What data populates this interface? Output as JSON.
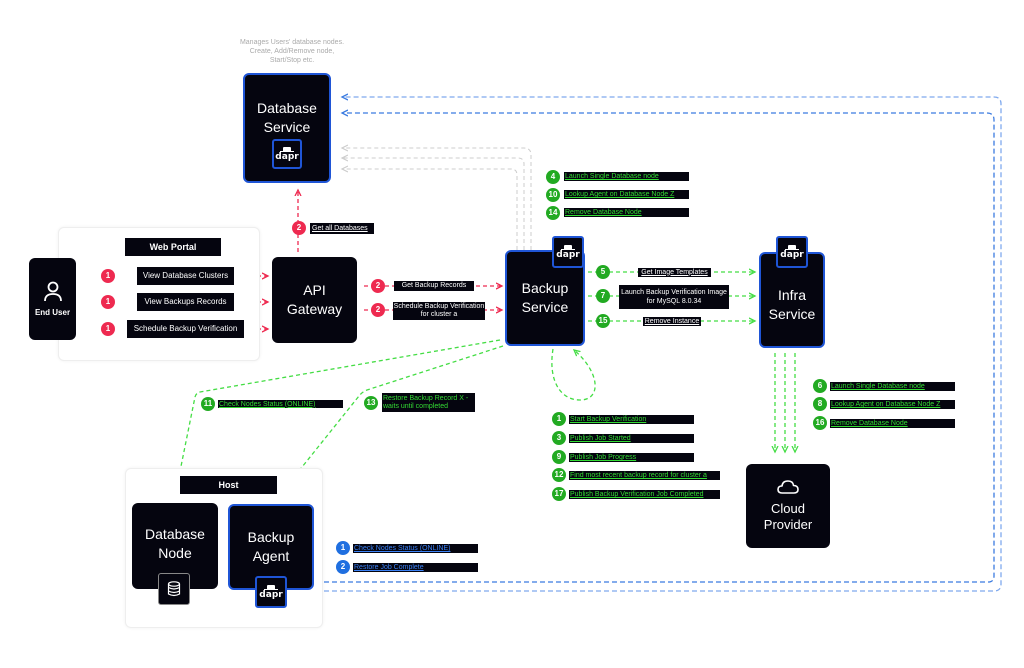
{
  "colors": {
    "node_bg": "#05050f",
    "dapr_border": "#1f55d6",
    "request_red": "#ee2a50",
    "event_green": "#22aa22",
    "green_text": "#33dd33",
    "agent_blue": "#1f6fe0",
    "grey_line": "#cccccc"
  },
  "nodes": {
    "database_service": {
      "title": "Database\nService",
      "note": "Manages Users' database nodes.\nCreate, Add/Remove node,\nStart/Stop etc.",
      "icon": "dapr-icon",
      "icon_text": "dapr"
    },
    "end_user": {
      "title": "End User",
      "icon": "user-icon"
    },
    "api_gateway": {
      "title": "API\nGateway"
    },
    "backup_service": {
      "title": "Backup\nService",
      "icon_text": "dapr"
    },
    "infra_service": {
      "title": "Infra\nService",
      "icon_text": "dapr"
    },
    "cloud_provider": {
      "title": "Cloud\nProvider",
      "icon": "cloud-icon"
    },
    "database_node": {
      "title": "Database\nNode",
      "icon": "database-icon"
    },
    "backup_agent": {
      "title": "Backup\nAgent",
      "icon_text": "dapr"
    }
  },
  "groups": {
    "web_portal": {
      "title": "Web Portal"
    },
    "host": {
      "title": "Host"
    }
  },
  "portal_requests": [
    {
      "step": "1",
      "label": "View Database Clusters"
    },
    {
      "step": "1",
      "label": "View Backups Records"
    },
    {
      "step": "1",
      "label": "Schedule Backup Verification"
    }
  ],
  "gateway_requests": [
    {
      "step": "2",
      "label": "Get all Databases"
    },
    {
      "step": "2",
      "label": "Get Backup Records"
    },
    {
      "step": "2",
      "label": "Schedule Backup Verification\nfor cluster a"
    }
  ],
  "database_service_events": [
    {
      "step": "4",
      "label": "Launch Single Database node"
    },
    {
      "step": "10",
      "label": "Lookup Agent on Database Node Z"
    },
    {
      "step": "14",
      "label": "Remove Database Node"
    }
  ],
  "infra_requests": [
    {
      "step": "5",
      "label": "Get Image Templates"
    },
    {
      "step": "7",
      "label": "Launch Backup Verification Image\nfor MySQL 8.0.34"
    },
    {
      "step": "15",
      "label": "Remove Instance"
    }
  ],
  "backup_self_events": [
    {
      "step": "1",
      "label": "Start Backup Verification"
    },
    {
      "step": "3",
      "label": "Publish Job Started"
    },
    {
      "step": "9",
      "label": "Publish Job Progress"
    },
    {
      "step": "12",
      "label": "Find most recent backup record for cluster a"
    },
    {
      "step": "17",
      "label": "Publish Backup Verification Job Completed"
    }
  ],
  "cloud_events": [
    {
      "step": "6",
      "label": "Launch Single Database node"
    },
    {
      "step": "8",
      "label": "Lookup Agent on Database Node Z"
    },
    {
      "step": "16",
      "label": "Remove Database Node"
    }
  ],
  "host_requests": [
    {
      "step": "11",
      "label": "Check Nodes Status (ONLINE)"
    },
    {
      "step": "13",
      "label": "Restore Backup Record X -\nwaits until completed"
    }
  ],
  "agent_events": [
    {
      "step": "1",
      "label": "Check Nodes Status (ONLINE)"
    },
    {
      "step": "2",
      "label": "Restore Job Complete"
    }
  ]
}
